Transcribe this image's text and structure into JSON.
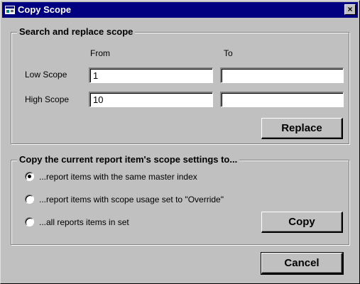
{
  "window": {
    "title": "Copy Scope",
    "close_glyph": "×"
  },
  "search_replace": {
    "group_title": "Search and replace scope",
    "from_header": "From",
    "to_header": "To",
    "low_scope_label": "Low Scope",
    "high_scope_label": "High Scope",
    "low_from_value": "1",
    "low_to_value": "",
    "high_from_value": "10",
    "high_to_value": "",
    "replace_label": "Replace"
  },
  "copy_settings": {
    "group_title": "Copy the current report item's scope settings to...",
    "options": [
      {
        "label": "...report items with the same master index",
        "selected": true
      },
      {
        "label": "...report items with scope usage set to \"Override\"",
        "selected": false
      },
      {
        "label": "...all reports items in set",
        "selected": false
      }
    ],
    "copy_label": "Copy"
  },
  "footer": {
    "cancel_label": "Cancel"
  },
  "colors": {
    "titlebar": "#000080",
    "face": "#c0c0c0"
  }
}
